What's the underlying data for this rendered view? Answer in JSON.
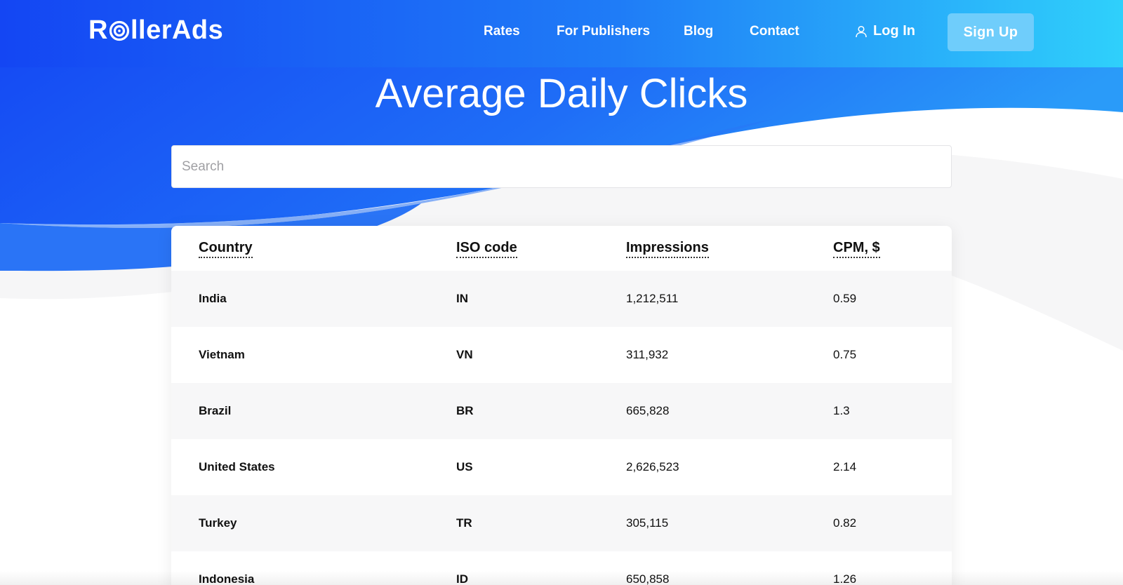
{
  "brand": {
    "logo_text_before": "R",
    "logo_text_after": "llerAds"
  },
  "nav": {
    "links": [
      "Rates",
      "For Publishers",
      "Blog",
      "Contact"
    ],
    "login_label": "Log In",
    "signup_label": "Sign Up"
  },
  "hero": {
    "title": "Average Daily Clicks"
  },
  "search": {
    "placeholder": "Search",
    "value": ""
  },
  "table": {
    "columns": [
      "Country",
      "ISO code",
      "Impressions",
      "CPM, $"
    ],
    "rows": [
      [
        "India",
        "IN",
        "1,212,511",
        "0.59"
      ],
      [
        "Vietnam",
        "VN",
        "311,932",
        "0.75"
      ],
      [
        "Brazil",
        "BR",
        "665,828",
        "1.3"
      ],
      [
        "United States",
        "US",
        "2,626,523",
        "2.14"
      ],
      [
        "Turkey",
        "TR",
        "305,115",
        "0.82"
      ],
      [
        "Indonesia",
        "ID",
        "650,858",
        "1.26"
      ]
    ]
  },
  "colors": {
    "header_gradient_start": "#1446f3",
    "header_gradient_end": "#2fd0fb",
    "signup_bg": "#6fcdfb",
    "page_bg": "#f6f6f7"
  },
  "icons": {
    "login": "user-icon",
    "logo_o": "target-icon"
  }
}
